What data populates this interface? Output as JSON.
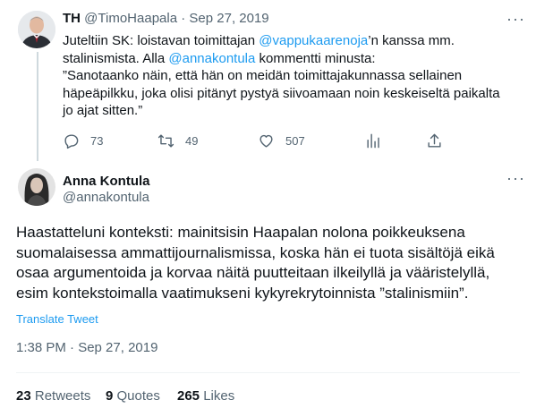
{
  "parent_tweet": {
    "avatar_icon": "person-avatar-icon",
    "display_name": "TH",
    "handle": "@TimoHaapala",
    "separator": "·",
    "date": "Sep 27, 2019",
    "body_lines": [
      [
        {
          "t": "Juteltiin SK: loistavan toimittajan "
        },
        {
          "t": "@vappukaarenoja",
          "m": true
        },
        {
          "t": "’n kanssa mm."
        }
      ],
      [
        {
          "t": "stalinismista. Alla "
        },
        {
          "t": "@annakontula",
          "m": true
        },
        {
          "t": " kommentti minusta:"
        }
      ],
      [
        {
          "t": "”Sanotaanko näin, että hän on meidän toimittajakunnassa sellainen"
        }
      ],
      [
        {
          "t": "häpeäpilkku, joka olisi pitänyt pystyä siivoamaan noin keskeiseltä paikalta"
        }
      ],
      [
        {
          "t": "jo ajat sitten.”"
        }
      ]
    ],
    "actions": {
      "reply_count": "73",
      "retweet_count": "49",
      "like_count": "507"
    }
  },
  "main_tweet": {
    "avatar_icon": "person-avatar-icon",
    "display_name": "Anna Kontula",
    "handle": "@annakontula",
    "body_lines": [
      "Haastatteluni konteksti: mainitsisin Haapalan nolona poikkeuksena",
      "suomalaisessa ammattijournalismissa, koska hän ei tuota sisältöjä eikä",
      "osaa argumentoida ja korvaa näitä puutteitaan ilkeilyllä ja vääristelyllä,",
      "esim kontekstoimalla vaatimukseni kykyrekrytoinnista ”stalinismiin”."
    ],
    "translate_label": "Translate Tweet",
    "timestamp": "1:38 PM · Sep 27, 2019",
    "stats": {
      "retweets_count": "23",
      "retweets_label": "Retweets",
      "quotes_count": "9",
      "quotes_label": "Quotes",
      "likes_count": "265",
      "likes_label": "Likes"
    }
  },
  "colors": {
    "link": "#1d9bf0",
    "muted": "#536471",
    "text": "#0f1419",
    "line": "#cfd9de"
  }
}
